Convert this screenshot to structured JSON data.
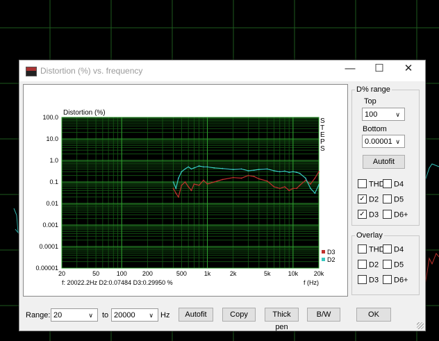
{
  "window": {
    "title": "Distortion (%) vs. frequency",
    "minimize": "—",
    "maximize": "☐",
    "close": "✕"
  },
  "chart_data": {
    "type": "line",
    "title": "Distortion (%)",
    "xlabel": "f (Hz)",
    "x_scale": "log",
    "y_scale": "log",
    "xlim": [
      20,
      20000
    ],
    "ylim": [
      1e-05,
      100
    ],
    "x_ticks": [
      "20",
      "50",
      "100",
      "200",
      "500",
      "1k",
      "2k",
      "5k",
      "10k",
      "20k"
    ],
    "y_ticks": [
      "100.0",
      "10.0",
      "1.0",
      "0.1",
      "0.01",
      "0.001",
      "0.0001",
      "0.00001"
    ],
    "side_label": "STEPS",
    "grid": true,
    "legend_position": "bottom-right",
    "readout": "f: 20022.2Hz     D2:0.07484  D3:0.29950 %",
    "series": [
      {
        "name": "D3",
        "color": "#c0302c",
        "x": [
          400,
          430,
          460,
          500,
          550,
          600,
          650,
          700,
          800,
          900,
          1000,
          1200,
          1500,
          2000,
          2500,
          3000,
          3500,
          4000,
          5000,
          6000,
          7000,
          8000,
          9000,
          10000,
          11000,
          12000,
          14000,
          16000,
          18000,
          20000
        ],
        "y": [
          0.05,
          0.03,
          0.02,
          0.07,
          0.1,
          0.06,
          0.04,
          0.08,
          0.07,
          0.12,
          0.08,
          0.1,
          0.13,
          0.16,
          0.15,
          0.2,
          0.18,
          0.14,
          0.11,
          0.06,
          0.05,
          0.06,
          0.04,
          0.05,
          0.05,
          0.07,
          0.12,
          0.08,
          0.15,
          0.3
        ]
      },
      {
        "name": "D2",
        "color": "#37c8c0",
        "x": [
          400,
          430,
          460,
          500,
          550,
          600,
          650,
          700,
          800,
          900,
          1000,
          1200,
          1500,
          2000,
          2500,
          3000,
          3500,
          4000,
          5000,
          6000,
          7000,
          8000,
          9000,
          10000,
          11000,
          12000,
          14000,
          16000,
          18000,
          20000
        ],
        "y": [
          0.1,
          0.05,
          0.15,
          0.3,
          0.4,
          0.5,
          0.4,
          0.45,
          0.55,
          0.5,
          0.5,
          0.45,
          0.42,
          0.38,
          0.4,
          0.33,
          0.35,
          0.38,
          0.4,
          0.33,
          0.3,
          0.32,
          0.28,
          0.3,
          0.28,
          0.25,
          0.15,
          0.05,
          0.03,
          0.075
        ]
      }
    ]
  },
  "panel": {
    "range_title": "D% range",
    "top_label": "Top",
    "top_value": "100",
    "bottom_label": "Bottom",
    "bottom_value": "0.00001",
    "autofit": "Autofit",
    "checks": [
      {
        "label": "THD",
        "checked": false
      },
      {
        "label": "D4",
        "checked": false
      },
      {
        "label": "D2",
        "checked": true
      },
      {
        "label": "D5",
        "checked": false
      },
      {
        "label": "D3",
        "checked": true
      },
      {
        "label": "D6+",
        "checked": false
      }
    ],
    "overlay_title": "Overlay",
    "overlay_checks": [
      {
        "label": "THD",
        "checked": false
      },
      {
        "label": "D4",
        "checked": false
      },
      {
        "label": "D2",
        "checked": false
      },
      {
        "label": "D5",
        "checked": false
      },
      {
        "label": "D3",
        "checked": false
      },
      {
        "label": "D6+",
        "checked": false
      }
    ]
  },
  "bottom": {
    "range_label": "Range:",
    "from_value": "20",
    "to_label": "to",
    "to_value": "20000",
    "unit": "Hz",
    "autofit": "Autofit",
    "copy": "Copy",
    "thick_pen": "Thick pen",
    "bw": "B/W",
    "ok": "OK"
  },
  "check_mark": "✓",
  "arrow": "∨"
}
